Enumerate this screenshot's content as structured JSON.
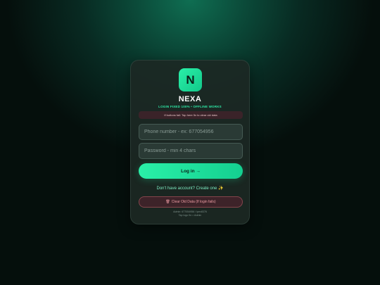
{
  "app": {
    "logo_letter": "N",
    "brand": "NEXA",
    "tagline": "LOGIN FIXED 100% • OFFLINE WORKS"
  },
  "notice": {
    "text": "If buttons fail: Tap here 5x to clear old data"
  },
  "form": {
    "phone_placeholder": "Phone number - ex: 677054956",
    "phone_value": "",
    "password_placeholder": "Password - min 4 chars",
    "password_value": "",
    "login_label": "Log in →",
    "signup_link": "Don't have account? Create one ✨",
    "clear_label": "Clear Old Data (If login fails)",
    "clear_icon": "trash-icon"
  },
  "footer": {
    "line1": "Admin: 677054956 / ipex8376",
    "line2": "Tap logo 5x = Admin"
  },
  "colors": {
    "accent": "#2af0a8",
    "danger": "#ee9ca3",
    "card": "#1c2824"
  }
}
